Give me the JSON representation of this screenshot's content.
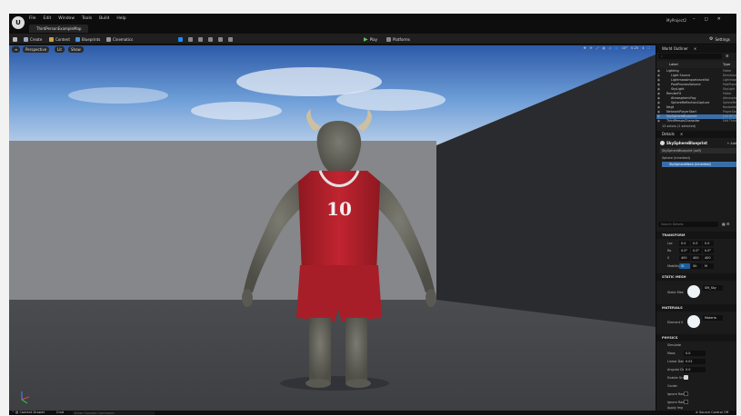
{
  "app": {
    "logo": "U",
    "menu": [
      "File",
      "Edit",
      "Window",
      "Tools",
      "Build",
      "Help"
    ],
    "map_tab": "ThirdPersonExampleMap",
    "project": "MyProject2",
    "window_buttons": [
      "–",
      "◻",
      "✕"
    ]
  },
  "toolbar": {
    "save_icon": "save-icon",
    "create": "Create",
    "content": "Content",
    "blueprints": "Blueprints",
    "cinematics": "Cinematics",
    "play": "Play",
    "platforms": "Platforms",
    "settings": "Settings"
  },
  "viewport": {
    "perspective": "Perspective",
    "lit": "Lit",
    "show": "Show",
    "snap_angle": "10°",
    "snap_scale": "0.25",
    "camera_speed": "4",
    "jersey_number": "10"
  },
  "outliner": {
    "tab": "World Outliner",
    "col_label": "Label",
    "col_type": "Type",
    "items": [
      {
        "label": "Lighting",
        "type": "Folder",
        "indent": 1
      },
      {
        "label": "Light Source",
        "type": "DirectionalL",
        "indent": 2
      },
      {
        "label": "LightmassImportanceVol",
        "type": "LightmassIm",
        "indent": 2
      },
      {
        "label": "PostProcessVolume",
        "type": "PostProcess",
        "indent": 2
      },
      {
        "label": "SkyLight",
        "type": "SkyLight",
        "indent": 2
      },
      {
        "label": "RenderFX",
        "type": "Folder",
        "indent": 1
      },
      {
        "label": "AtmosphericFog",
        "type": "Atmospher",
        "indent": 2
      },
      {
        "label": "SphereReflectionCapture",
        "type": "SphereRefl",
        "indent": 2
      },
      {
        "label": "Negt",
        "type": "Nonbeddable",
        "indent": 1
      },
      {
        "label": "NetworkPlayerStart",
        "type": "PlayerStart",
        "indent": 1
      },
      {
        "label": "SkySphereBlueprint",
        "type": "Edit BP_Sk",
        "indent": 1,
        "selected": true
      },
      {
        "label": "ThirdPersonCharacter",
        "type": "Edit ThirdP",
        "indent": 1
      }
    ],
    "count": "13 actors (1 selected)"
  },
  "details": {
    "tab": "Details",
    "actor": "SkySphereBlueprint",
    "add": "+ Add",
    "instance": "SkySphereBlueprint (self)",
    "sphere": "Sphere (Inherited)",
    "mesh": "SkySphereMesh (Inherited)",
    "search": "Search Details",
    "transform": "TRANSFORM",
    "location": {
      "label": "Loc",
      "values": [
        "0.0",
        "0.0",
        "0.0"
      ]
    },
    "rotation": {
      "label": "Ro",
      "values": [
        "0.0°",
        "0.0°",
        "0.0°"
      ]
    },
    "scale": {
      "label": "S",
      "values": [
        "400",
        "400",
        "400"
      ]
    },
    "mobility": {
      "label": "Mobility",
      "options": [
        "St",
        "Sti",
        "M"
      ]
    },
    "static_mesh_header": "STATIC MESH",
    "static_mesh_label": "Static Mes",
    "static_mesh_value": "SM_Sky",
    "materials_header": "MATERIALS",
    "element_label": "Element 0",
    "material_value": "Materia",
    "physics_header": "PHYSICS",
    "simulate_label": "Simulate",
    "mass_label": "Mass",
    "mass_value": "0.0",
    "linear_damping_label": "Linear Dam",
    "linear_damping_value": "0.01",
    "angular_damping_label": "Angular Da",
    "angular_damping_value": "0.0",
    "enable_gravity_label": "Enable Gra",
    "constraints_label": "Constr",
    "ignore_radial_impulse": "Ignore Rad",
    "ignore_radial_force": "Ignore Rad",
    "apply_impulse": "Apply Imp"
  },
  "statusbar": {
    "content_drawer": "Content Drawer",
    "cmd": "Cmd",
    "console_placeholder": "Enter Console Command",
    "source_control": "Source Control Off"
  },
  "colors": {
    "accent_blue": "#1a8cff",
    "play_green": "#5cc85c",
    "jersey_red": "#b8202a",
    "selection": "#3a6ea8"
  }
}
